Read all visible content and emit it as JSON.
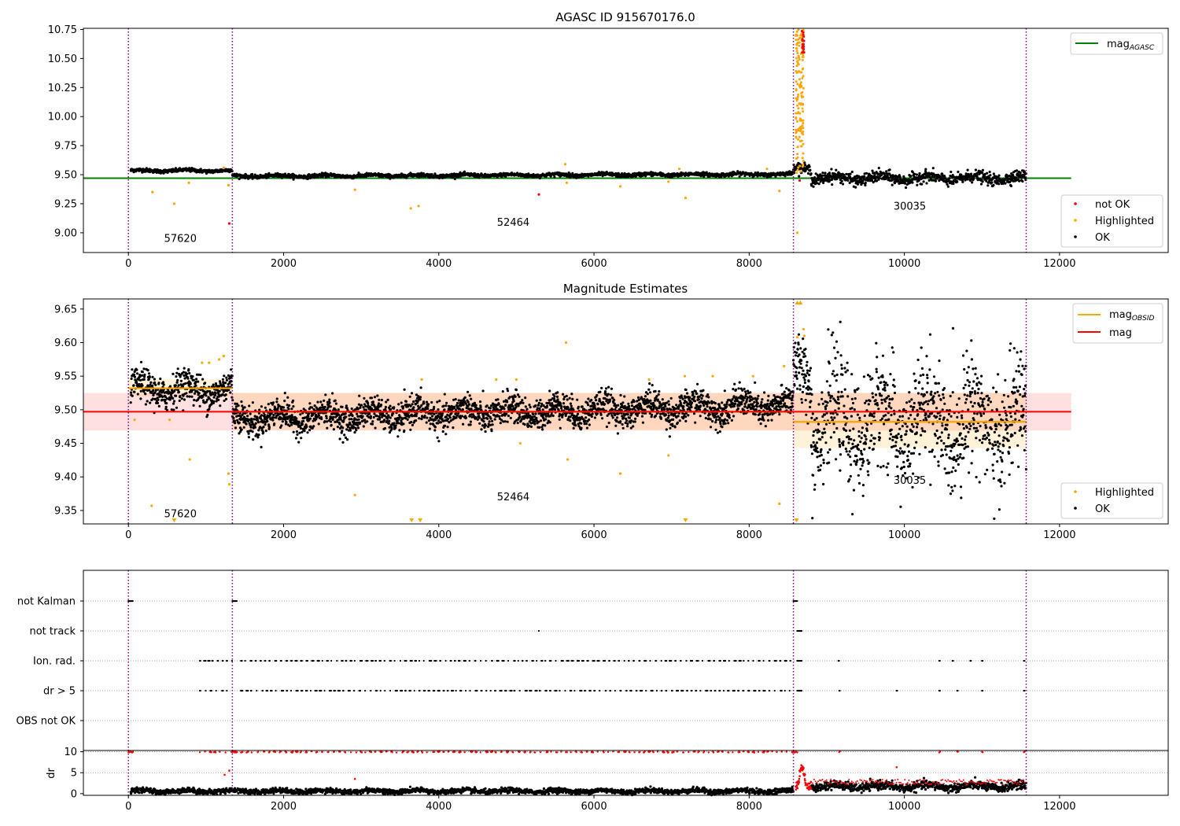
{
  "chart_data": [
    {
      "type": "scatter",
      "title": "AGASC ID 915670176.0",
      "xlim": [
        -580,
        13400
      ],
      "ylim": [
        8.83,
        10.76
      ],
      "x_ticks": [
        0,
        2000,
        4000,
        6000,
        8000,
        10000,
        12000
      ],
      "y_ticks": [
        9.0,
        9.25,
        9.5,
        9.75,
        10.0,
        10.25,
        10.5,
        10.75
      ],
      "y_tick_labels": [
        "9.00",
        "9.25",
        "9.50",
        "9.75",
        "10.00",
        "10.25",
        "10.50",
        "10.75"
      ],
      "obs_boundaries": [
        0,
        1340,
        8570,
        11570
      ],
      "obs_labels": [
        {
          "text": "57620",
          "x": 670,
          "y": 8.92
        },
        {
          "text": "52464",
          "x": 4960,
          "y": 9.06
        },
        {
          "text": "30035",
          "x": 10070,
          "y": 9.2
        }
      ],
      "reference_line": {
        "name": "mag_AGASC",
        "y": 9.47,
        "x": [
          -580,
          12150
        ],
        "color": "#008000"
      },
      "segments": [
        {
          "x": [
            30,
            1340
          ],
          "mean": 9.535,
          "sd": 0.008,
          "trend": 0.0
        },
        {
          "x": [
            1340,
            8570
          ],
          "mean": 9.487,
          "sd": 0.008,
          "trend": 0.018
        },
        {
          "x": [
            8570,
            8800
          ],
          "mean": 9.56,
          "sd": 0.02,
          "trend": 0.0
        },
        {
          "x": [
            8800,
            11570
          ],
          "mean": 9.47,
          "sd": 0.025,
          "trend": 0.0
        }
      ],
      "highlighted_points": [
        [
          310,
          9.35
        ],
        [
          590,
          9.25
        ],
        [
          780,
          9.43
        ],
        [
          1290,
          9.41
        ],
        [
          2920,
          9.37
        ],
        [
          3640,
          9.21
        ],
        [
          3740,
          9.23
        ],
        [
          5650,
          9.43
        ],
        [
          6340,
          9.4
        ],
        [
          6960,
          9.44
        ],
        [
          7180,
          9.3
        ],
        [
          8390,
          9.36
        ],
        [
          8620,
          9.0
        ],
        [
          5630,
          9.59
        ],
        [
          1230,
          9.56
        ],
        [
          7100,
          9.55
        ],
        [
          8230,
          9.55
        ]
      ],
      "not_ok_points": [
        [
          1300,
          9.08
        ],
        [
          5290,
          9.33
        ],
        [
          8650,
          9.45
        ]
      ],
      "spike": {
        "x": [
          8600,
          8700
        ],
        "y_range": [
          9.5,
          10.76
        ]
      },
      "legends": [
        {
          "position": "top-right",
          "entries": [
            {
              "label": "mag",
              "sub": "AGASC",
              "color": "#008000",
              "kind": "line"
            }
          ]
        },
        {
          "position": "bottom-right",
          "entries": [
            {
              "label": "not OK",
              "color": "#ff0000",
              "kind": "dot"
            },
            {
              "label": "Highlighted",
              "color": "#ffa500",
              "kind": "dot"
            },
            {
              "label": "OK",
              "color": "#000000",
              "kind": "dot"
            }
          ]
        }
      ]
    },
    {
      "type": "scatter",
      "title": "Magnitude Estimates",
      "xlim": [
        -580,
        13400
      ],
      "ylim": [
        9.33,
        9.665
      ],
      "x_ticks": [
        0,
        2000,
        4000,
        6000,
        8000,
        10000,
        12000
      ],
      "y_ticks": [
        9.35,
        9.4,
        9.45,
        9.5,
        9.55,
        9.6,
        9.65
      ],
      "y_tick_labels": [
        "9.35",
        "9.40",
        "9.45",
        "9.50",
        "9.55",
        "9.60",
        "9.65"
      ],
      "obs_boundaries": [
        0,
        1340,
        8570,
        11570
      ],
      "obs_labels": [
        {
          "text": "57620",
          "x": 670,
          "y": 9.34
        },
        {
          "text": "52464",
          "x": 4960,
          "y": 9.365
        },
        {
          "text": "30035",
          "x": 10070,
          "y": 9.39
        }
      ],
      "mag_line": {
        "name": "mag",
        "y": 9.497,
        "band": [
          9.469,
          9.525
        ],
        "x": [
          -580,
          12150
        ],
        "color": "#ff0000"
      },
      "obsid_lines": [
        {
          "x": [
            0,
            1340
          ],
          "y": 9.532,
          "band": [
            9.52,
            9.545
          ]
        },
        {
          "x": [
            1340,
            8570
          ],
          "y": 9.497,
          "band": [
            9.47,
            9.525
          ]
        },
        {
          "x": [
            8570,
            11570
          ],
          "y": 9.482,
          "band": [
            9.443,
            9.525
          ]
        }
      ],
      "segments": [
        {
          "x": [
            30,
            1340
          ],
          "mean": 9.53,
          "sd": 0.012,
          "trend": 0.0
        },
        {
          "x": [
            1340,
            8570
          ],
          "mean": 9.487,
          "sd": 0.011,
          "trend": 0.02
        },
        {
          "x": [
            8570,
            8800
          ],
          "mean": 9.56,
          "sd": 0.025,
          "trend": 0.0
        },
        {
          "x": [
            8800,
            11570
          ],
          "mean": 9.48,
          "sd": 0.04,
          "trend": 0.0
        }
      ],
      "highlighted_points": [
        [
          80,
          9.485
        ],
        [
          300,
          9.357
        ],
        [
          530,
          9.485
        ],
        [
          790,
          9.426
        ],
        [
          1290,
          9.405
        ],
        [
          1300,
          9.389
        ],
        [
          2920,
          9.373
        ],
        [
          5050,
          9.45
        ],
        [
          5640,
          9.6
        ],
        [
          5660,
          9.426
        ],
        [
          6340,
          9.405
        ],
        [
          6960,
          9.432
        ],
        [
          8390,
          9.36
        ],
        [
          8620,
          9.608
        ],
        [
          8700,
          9.62
        ],
        [
          8710,
          9.61
        ],
        [
          950,
          9.57
        ],
        [
          1170,
          9.575
        ],
        [
          1230,
          9.58
        ],
        [
          1040,
          9.57
        ],
        [
          3780,
          9.545
        ],
        [
          4740,
          9.545
        ],
        [
          5000,
          9.545
        ],
        [
          6710,
          9.545
        ],
        [
          7170,
          9.55
        ],
        [
          7530,
          9.55
        ],
        [
          8050,
          9.55
        ],
        [
          8450,
          9.565
        ]
      ],
      "arrows_low": [
        590,
        3650,
        3760,
        7180,
        8610
      ],
      "arrows_high": [
        8620,
        8660
      ],
      "legends": [
        {
          "position": "top-right",
          "entries": [
            {
              "label": "mag",
              "sub": "OBSID",
              "color": "#ffa500",
              "kind": "line"
            },
            {
              "label": "mag",
              "sub": "",
              "color": "#ff0000",
              "kind": "line"
            }
          ]
        },
        {
          "position": "bottom-right",
          "entries": [
            {
              "label": "Highlighted",
              "color": "#ffa500",
              "kind": "dot"
            },
            {
              "label": "OK",
              "color": "#000000",
              "kind": "dot"
            }
          ]
        }
      ]
    },
    {
      "type": "scatter",
      "title": "",
      "xlim": [
        -580,
        13400
      ],
      "categories": [
        "not Kalman",
        "not track",
        "Ion. rad.",
        "dr > 5",
        "OBS not OK"
      ],
      "obs_boundaries": [
        0,
        1340,
        8570,
        11570
      ],
      "flags": {
        "not Kalman": [
          [
            0,
            60
          ],
          [
            1340,
            1400
          ],
          [
            8570,
            8620
          ]
        ],
        "not track": [
          [
            5290,
            5295
          ],
          [
            8620,
            8680
          ]
        ],
        "Ion. rad.": [
          [
            920,
            1340
          ],
          [
            1450,
            8570
          ],
          [
            9150,
            9160
          ],
          [
            10450,
            10460
          ],
          [
            10620,
            10630
          ],
          [
            10850,
            10860
          ],
          [
            11000,
            11010
          ],
          [
            11540,
            11550
          ],
          [
            8620,
            8680
          ]
        ],
        "dr > 5": [
          [
            920,
            1340
          ],
          [
            1450,
            8570
          ],
          [
            9160,
            9170
          ],
          [
            9900,
            9910
          ],
          [
            10450,
            10460
          ],
          [
            10680,
            10690
          ],
          [
            11000,
            11010
          ],
          [
            11540,
            11550
          ],
          [
            8620,
            8680
          ]
        ],
        "OBS not OK": []
      },
      "ylabel": "",
      "legends": []
    },
    {
      "type": "scatter",
      "title": "",
      "xlim": [
        -580,
        13400
      ],
      "ylim": [
        -0.4,
        10.3
      ],
      "ylabel": "dr",
      "y_ticks": [
        0,
        5,
        10
      ],
      "y_tick_labels": [
        "0",
        "5",
        "10"
      ],
      "x_ticks": [
        0,
        2000,
        4000,
        6000,
        8000,
        10000,
        12000
      ],
      "obs_boundaries": [
        0,
        1340,
        8570,
        11570
      ],
      "segments": [
        {
          "x": [
            30,
            1340
          ],
          "mean": 0.6,
          "sd": 0.3,
          "trend": 0.0
        },
        {
          "x": [
            1340,
            8570
          ],
          "mean": 0.6,
          "sd": 0.3,
          "trend": 0.0
        },
        {
          "x": [
            8800,
            11570
          ],
          "mean": 1.7,
          "sd": 0.5,
          "trend": 0.0
        }
      ],
      "red_high_ranges": [
        [
          0,
          60
        ],
        [
          920,
          1340
        ],
        [
          1340,
          1400
        ],
        [
          1450,
          8570
        ],
        [
          8570,
          8620
        ],
        [
          9160,
          9170
        ],
        [
          10450,
          10460
        ],
        [
          10680,
          10690
        ],
        [
          11000,
          11010
        ],
        [
          11540,
          11550
        ]
      ],
      "red_points": [
        [
          1240,
          4.5
        ],
        [
          1300,
          5.5
        ],
        [
          2920,
          3.5
        ],
        [
          9900,
          6.3
        ],
        [
          8640,
          3.0
        ],
        [
          8680,
          6.0
        ],
        [
          8720,
          4.5
        ]
      ],
      "legends": []
    }
  ]
}
